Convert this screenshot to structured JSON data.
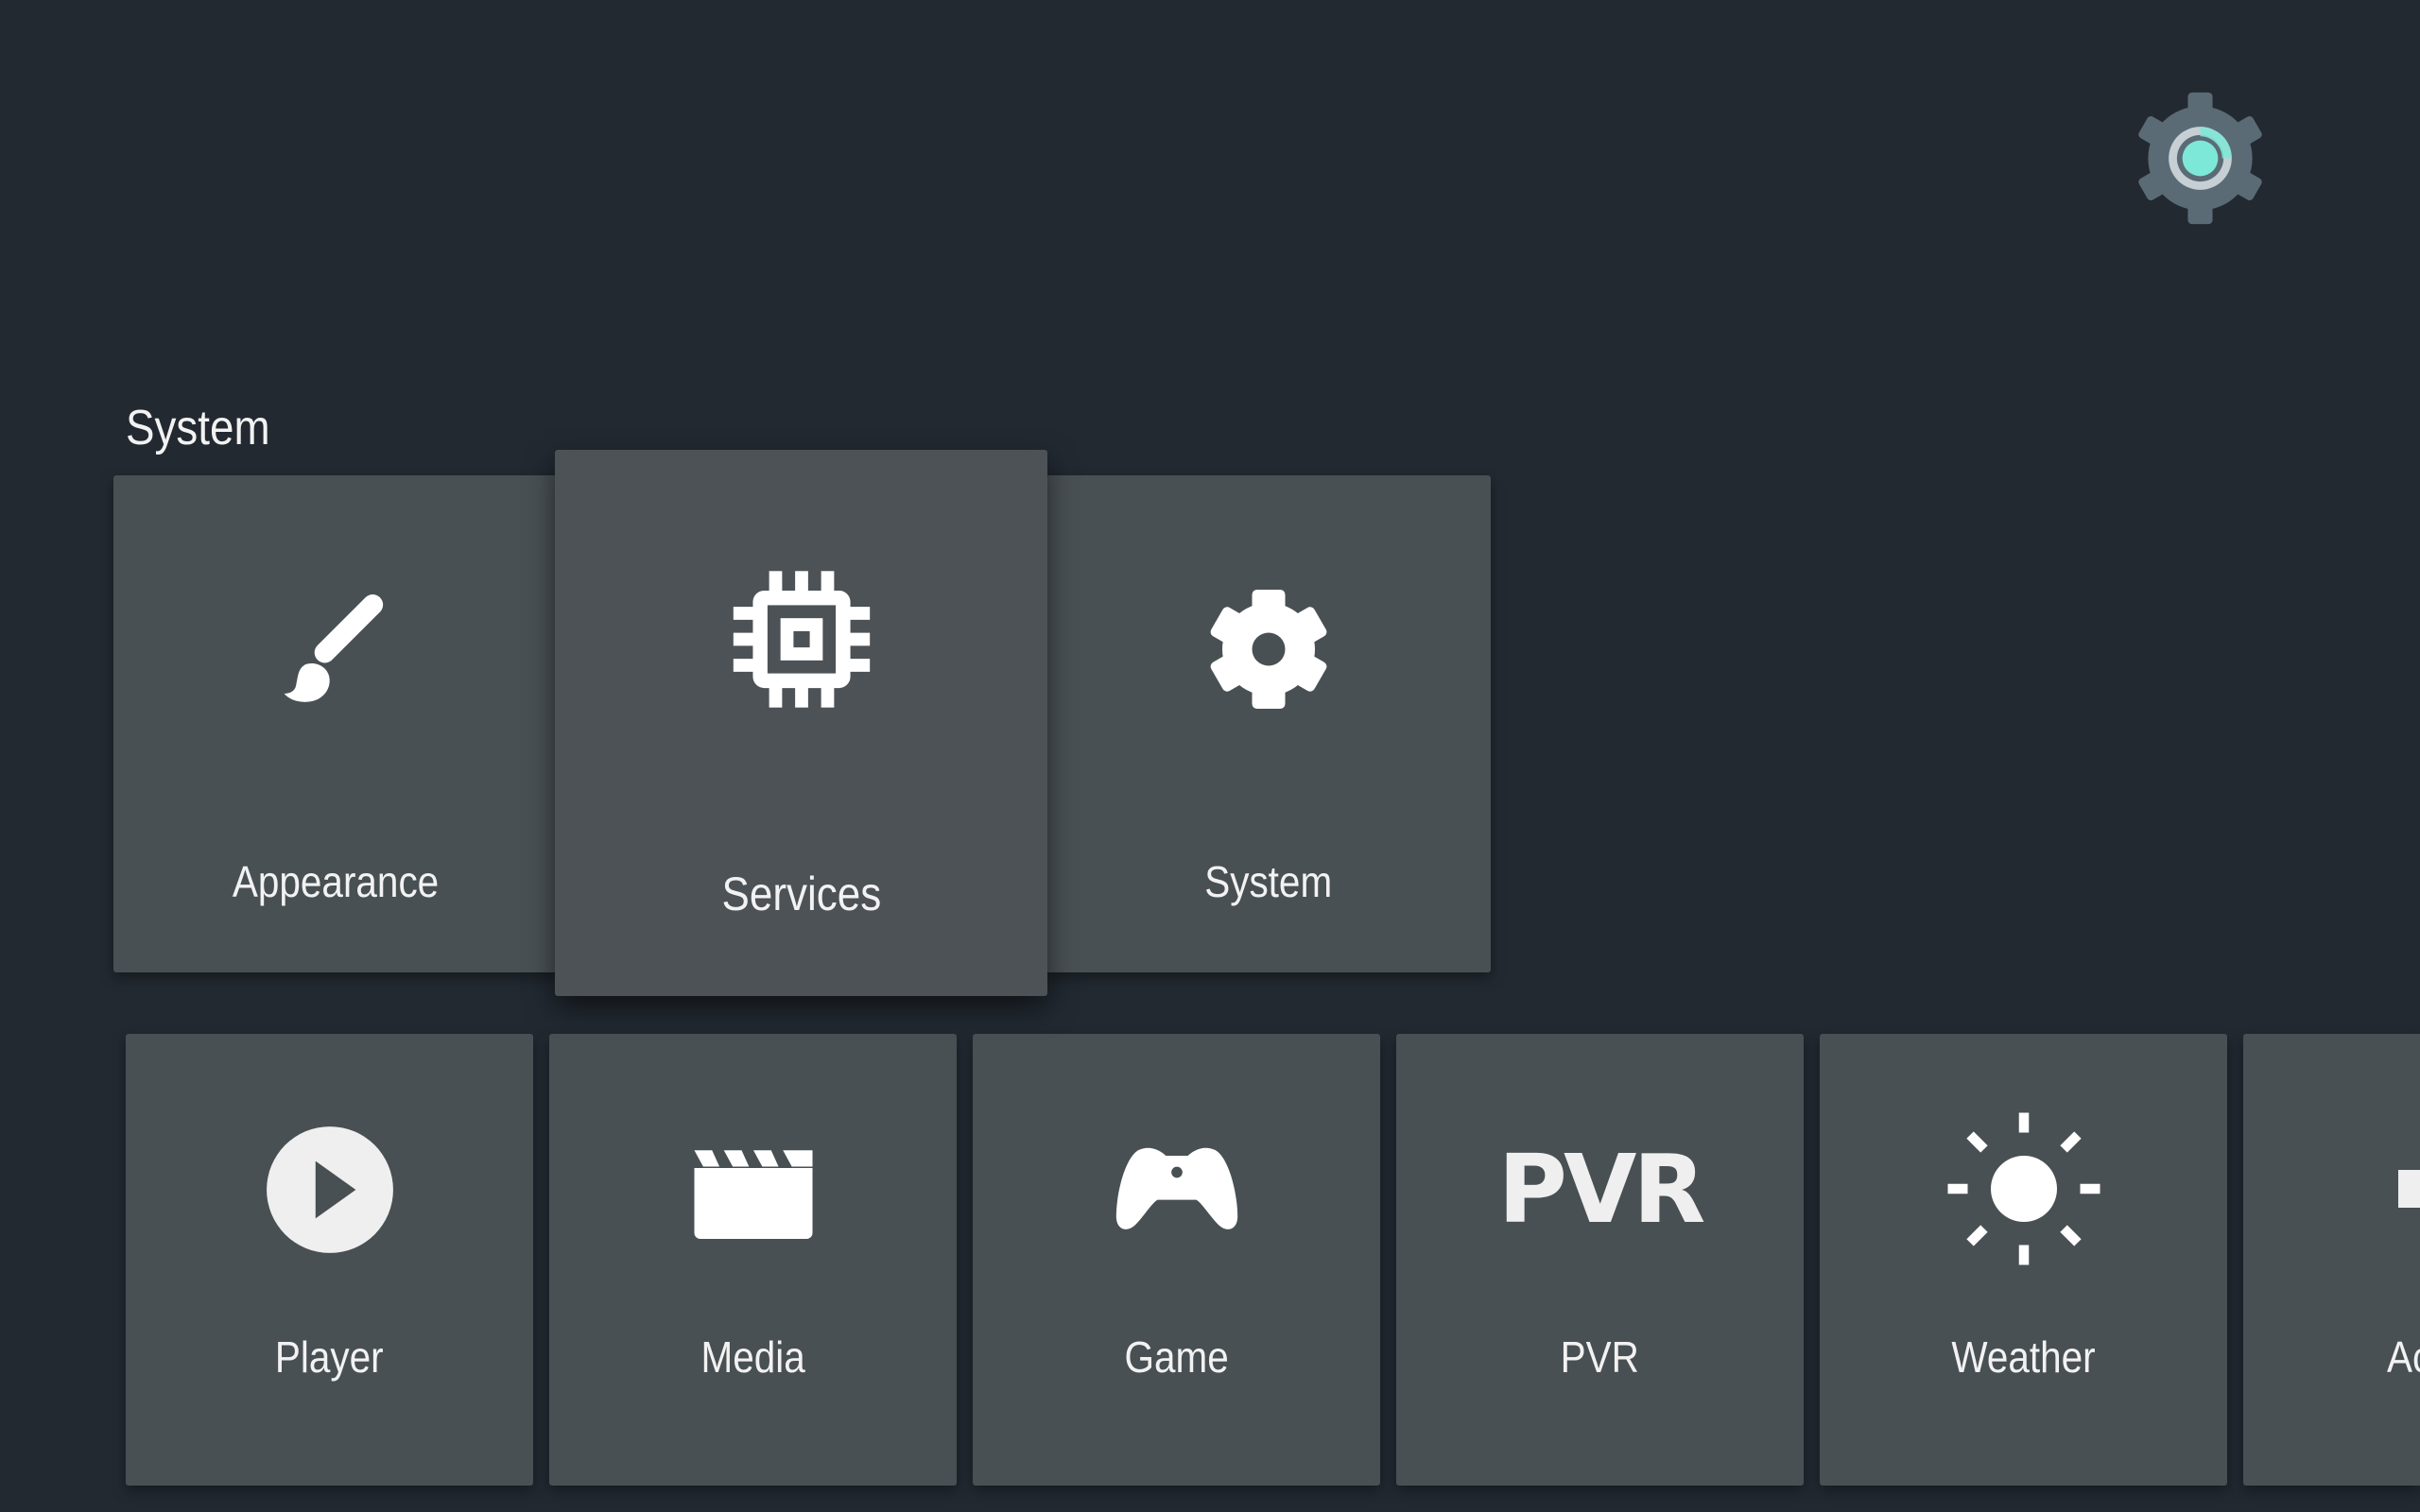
{
  "header": {
    "logo_icon": "settings-gear-icon",
    "logo_colors": {
      "gear": "#5b6b75",
      "ring": "#c6cfd3",
      "center": "#7ee8d8",
      "background": "#222931"
    }
  },
  "section": {
    "title": "System",
    "tiles": [
      {
        "label": "Appearance",
        "icon": "paintbrush-icon",
        "focused": false
      },
      {
        "label": "Services",
        "icon": "chip-icon",
        "focused": true
      },
      {
        "label": "System",
        "icon": "gear-icon",
        "focused": false
      }
    ]
  },
  "bottom_row": {
    "tiles": [
      {
        "label": "Player",
        "icon": "play-circle-icon"
      },
      {
        "label": "Media",
        "icon": "clapperboard-icon"
      },
      {
        "label": "Game",
        "icon": "gamepad-icon"
      },
      {
        "label": "PVR",
        "icon": "pvr-icon",
        "icon_text": "PVR"
      },
      {
        "label": "Weather",
        "icon": "sun-icon"
      },
      {
        "label": "Ac",
        "icon": "partial-icon"
      }
    ]
  },
  "colors": {
    "background": "#222931",
    "tile": "#495054",
    "text": "#f2f2f2",
    "icon": "#ffffff"
  }
}
